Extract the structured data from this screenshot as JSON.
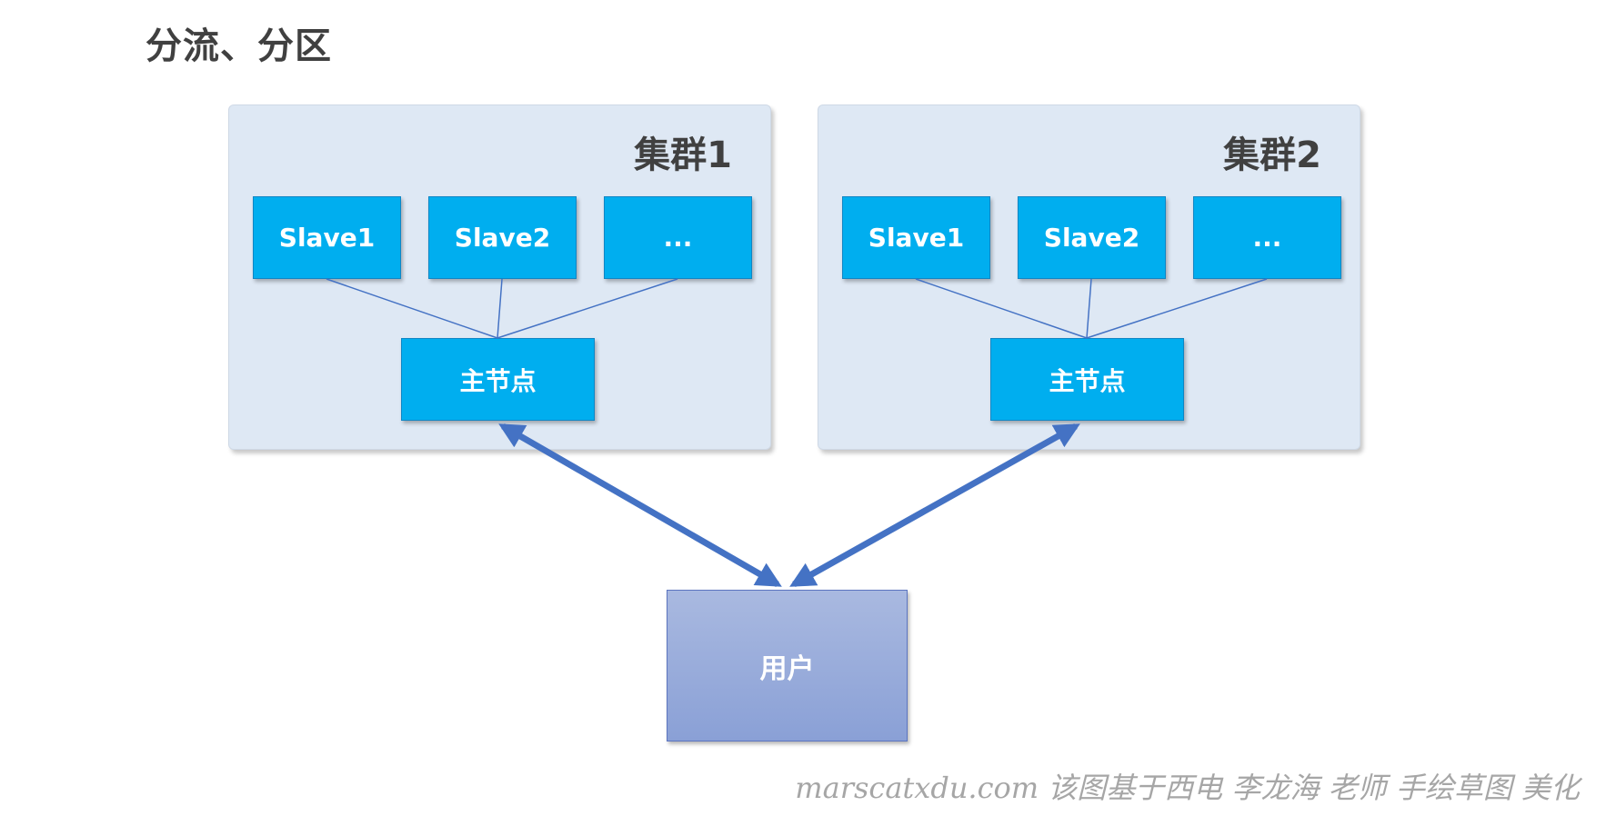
{
  "title": "分流、分区",
  "clusters": [
    {
      "label": "集群1",
      "slaves": [
        "Slave1",
        "Slave2",
        "..."
      ],
      "master": "主节点"
    },
    {
      "label": "集群2",
      "slaves": [
        "Slave1",
        "Slave2",
        "..."
      ],
      "master": "主节点"
    }
  ],
  "user": "用户",
  "caption": "marscatxdu.com 该图基于西电 李龙海 老师 手绘草图 美化",
  "colors": {
    "node_fill": "#00aeef",
    "cluster_fill": "#dee8f4",
    "arrow": "#4472c4",
    "user_fill": "#8faadc"
  }
}
